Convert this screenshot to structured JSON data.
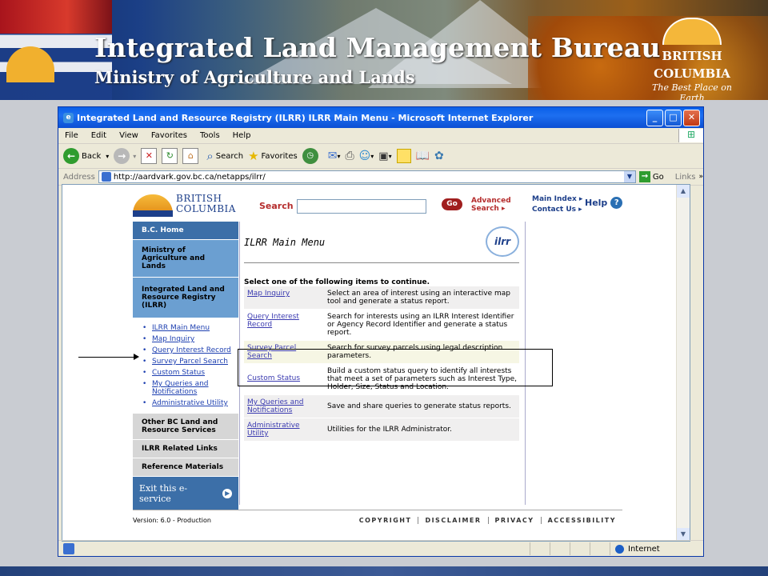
{
  "banner": {
    "title": "Integrated Land Management Bureau",
    "subtitle": "Ministry of Agriculture and Lands",
    "logo_line1": "BRITISH",
    "logo_line2": "COLUMBIA",
    "logo_tagline": "The Best Place on Earth"
  },
  "window": {
    "title": "Integrated Land and Resource Registry (ILRR) ILRR Main Menu - Microsoft Internet Explorer",
    "minimize": "_",
    "maximize": "□",
    "close": "✕"
  },
  "menubar": [
    "File",
    "Edit",
    "View",
    "Favorites",
    "Tools",
    "Help"
  ],
  "toolbar": {
    "back": "Back",
    "search": "Search",
    "favorites": "Favorites"
  },
  "addressbar": {
    "label": "Address",
    "url": "http://aardvark.gov.bc.ca/netapps/ilrr/",
    "go": "Go",
    "links": "Links"
  },
  "page": {
    "logo_line1": "BRITISH",
    "logo_line2": "COLUMBIA",
    "search_label": "Search",
    "search_value": "",
    "go": "Go",
    "advanced_search_1": "Advanced",
    "advanced_search_2": "Search ▸",
    "main_index": "Main Index ▸",
    "contact_us": "Contact Us ▸",
    "help": "Help",
    "left_nav": {
      "home": "B.C. Home",
      "ministry": "Ministry of Agriculture and Lands",
      "registry": "Integrated Land and Resource Registry (ILRR)",
      "links": [
        "ILRR Main Menu",
        "Map Inquiry",
        "Query Interest Record",
        "Survey Parcel Search",
        "Custom Status",
        "My Queries and Notifications",
        "Administrative Utility"
      ],
      "other_services": "Other BC Land and Resource Services",
      "related_links": "ILRR Related Links",
      "reference": "Reference Materials",
      "exit": "Exit this e-service"
    },
    "main": {
      "title": "ILRR Main Menu",
      "logo_text": "ilrr",
      "instruction": "Select one of the following items to continue.",
      "options": [
        {
          "label": "Map Inquiry",
          "description": "Select an area of interest using an interactive map tool and generate a status report."
        },
        {
          "label": "Query Interest Record",
          "description": "Search for interests using an ILRR Interest Identifier or Agency Record Identifier and generate a status report."
        },
        {
          "label": "Survey Parcel Search",
          "description": "Search for survey parcels using legal description parameters."
        },
        {
          "label": "Custom Status",
          "description": "Build a custom status query to identify all interests that meet a set of parameters such as Interest Type, Holder, Size, Status and Location."
        },
        {
          "label": "My Queries and Notifications",
          "description": "Save and share queries to generate status reports."
        },
        {
          "label": "Administrative Utility",
          "description": "Utilities for the ILRR Administrator."
        }
      ]
    },
    "footer": {
      "version": "Version: 6.0 - Production",
      "links": [
        "COPYRIGHT",
        "DISCLAIMER",
        "PRIVACY",
        "ACCESSIBILITY"
      ]
    }
  },
  "statusbar": {
    "zone": "Internet"
  }
}
